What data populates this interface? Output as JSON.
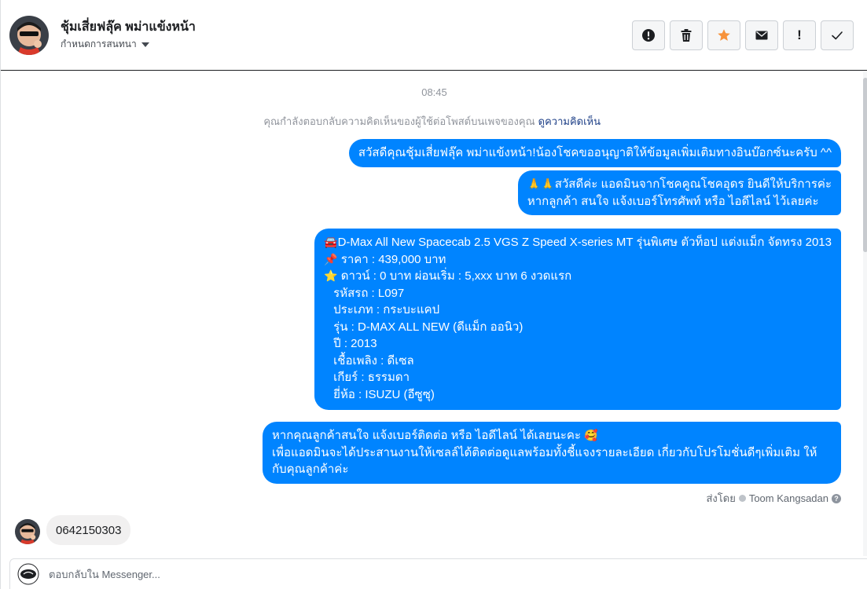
{
  "header": {
    "contact_name": "ชุ้มเสี่ยฟลุ๊ค พม่าแข้งหน้า",
    "assign_label": "กำหนดการสนทนา",
    "actions": [
      {
        "name": "spam-icon"
      },
      {
        "name": "trash-icon"
      },
      {
        "name": "star-icon",
        "color": "#f7923b"
      },
      {
        "name": "envelope-icon"
      },
      {
        "name": "exclamation-icon",
        "label": "!"
      },
      {
        "name": "checkmark-icon"
      }
    ]
  },
  "conversation": {
    "timestamp": "08:45",
    "context_note": "คุณกำลังตอบกลับความคิดเห็นของผู้ใช้ต่อโพสต์บนเพจของคุณ",
    "context_link": "ดูความคิดเห็น",
    "outgoing_color": "#0084ff",
    "messages": {
      "m1": "สวัสดีคุณชุ้มเสี่ยฟลุ๊ค พม่าแข้งหน้า!น้องโชคขออนุญาติให้ข้อมูลเพิ่มเติมทางอินบ๊อกซ์นะครับ ^^",
      "m2": {
        "emoji": "🙏🙏",
        "line1": "สวัสดีค่ะ แอดมินจากโชคคูณโชคอุดร ยินดีให้บริการค่ะ",
        "line2": "หากลูกค้า สนใจ แจ้งเบอร์โทรศัพท์ หรือ ไอดีไลน์  ไว้เลยค่ะ"
      },
      "m3": {
        "car_emoji": "🚘",
        "title": "D-Max All New Spacecab 2.5 VGS Z Speed X-series MT รุ่นพิเศษ ตัวท็อป แต่งแม็ก จัดทรง 2013",
        "pin_emoji": "📌",
        "price": " ราคา : 439,000 บาท",
        "star_emoji": "⭐",
        "down": " ดาวน์ : 0 บาท ผ่อนเริ่ม : 5,xxx บาท 6 งวดแรก",
        "code": "รหัสรถ : L097",
        "type": "ประเภท : กระบะแคป",
        "model": "รุ่น : D-MAX ALL NEW (ดีแม็ก ออนิว)",
        "year": "ปี : 2013",
        "fuel": "เชื้อเพลิง : ดีเซล",
        "gear": "เกียร์ : ธรรมดา",
        "brand": "ยี่ห้อ : ISUZU (อีซูซุ)"
      },
      "m4": {
        "line1": "หากคุณลูกค้าสนใจ แจ้งเบอร์ติดต่อ หรือ ไอดีไลน์ ได้เลยนะคะ",
        "emoji": "🥰",
        "line2": "เพื่อแอดมินจะได้ประสานงานให้เซลล์ได้ติดต่อดูแลพร้อมทั้งชี้แจงรายละเอียด เกี่ยวกับโปรโมชั่นดีๆเพิ่มเติม ให้กับคุณลูกค้าค่ะ"
      }
    },
    "sent_by_label": "ส่งโดย",
    "sent_by_name": "Toom Kangsadan",
    "incoming_message": "0642150303"
  },
  "composer": {
    "placeholder": "ตอบกลับใน Messenger..."
  }
}
